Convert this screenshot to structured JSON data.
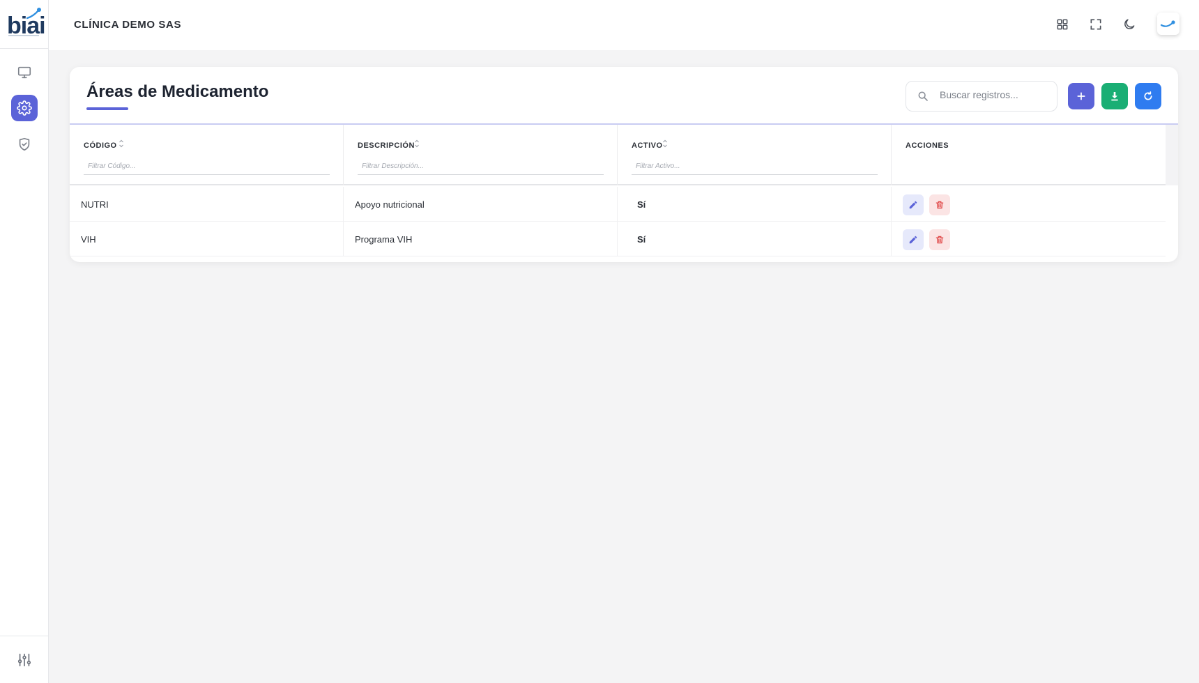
{
  "app": {
    "logo_text": "biai"
  },
  "header": {
    "company": "CLÍNICA DEMO SAS",
    "icons": [
      "grid-icon",
      "fullscreen-icon",
      "moon-icon",
      "avatar"
    ]
  },
  "sidebar": {
    "items": [
      {
        "icon": "monitor-icon",
        "active": false
      },
      {
        "icon": "gear-icon",
        "active": true
      },
      {
        "icon": "shield-check-icon",
        "active": false
      }
    ],
    "bottom_icon": "sliders-icon"
  },
  "card": {
    "title": "Áreas de Medicamento",
    "search_placeholder": "Buscar registros...",
    "buttons": [
      {
        "icon": "plus-icon",
        "color": "#5b63d8"
      },
      {
        "icon": "download-icon",
        "color": "#1aae74"
      },
      {
        "icon": "refresh-icon",
        "color": "#2f7cf0"
      }
    ]
  },
  "table": {
    "columns": [
      {
        "label": "CÓDIGO",
        "filter_placeholder": "Filtrar Código..."
      },
      {
        "label": "DESCRIPCIÓN",
        "filter_placeholder": "Filtrar Descripción..."
      },
      {
        "label": "ACTIVO",
        "filter_placeholder": "Filtrar Activo..."
      },
      {
        "label": "ACCIONES"
      }
    ],
    "rows": [
      {
        "codigo": "NUTRI",
        "descripcion": "Apoyo nutricional",
        "activo": "Sí"
      },
      {
        "codigo": "VIH",
        "descripcion": "Programa VIH",
        "activo": "Sí"
      }
    ]
  },
  "colors": {
    "accent": "#5b63d8",
    "success": "#1aae74",
    "info": "#2f7cf0",
    "danger": "#e04848"
  }
}
